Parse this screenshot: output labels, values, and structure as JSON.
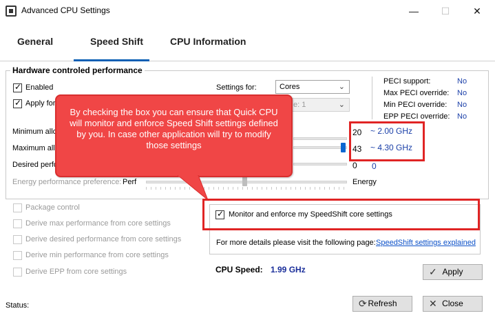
{
  "window": {
    "title": "Advanced CPU Settings",
    "min_glyph": "—",
    "max_glyph": "☐",
    "close_glyph": "✕"
  },
  "tabs": [
    {
      "label": "General",
      "active": false
    },
    {
      "label": "Speed Shift",
      "active": true
    },
    {
      "label": "CPU Information",
      "active": false
    }
  ],
  "hardware": {
    "title": "Hardware controled performance",
    "enabled_label": "Enabled",
    "apply_label": "Apply for",
    "settings_for_label": "Settings for:",
    "settings_for_value": "Cores",
    "core_select_value": "e: 1",
    "min_label": "Minimum allo",
    "max_label": "Maximum allo",
    "desired_label": "Desired perfo",
    "epp_label": "Energy performance preference:",
    "epp_left": "Perf",
    "epp_right": "Energy",
    "min_value": "20",
    "min_freq": "~ 2.00 GHz",
    "max_value": "43",
    "max_freq": "~ 4.30 GHz",
    "desired_value": "0",
    "desired_freq": "0"
  },
  "peci": [
    {
      "label": "PECI support:",
      "value": "No"
    },
    {
      "label": "Max PECI override:",
      "value": "No"
    },
    {
      "label": "Min PECI override:",
      "value": "No"
    },
    {
      "label": "EPP PECI override:",
      "value": "No"
    }
  ],
  "options": [
    {
      "label": "Package control"
    },
    {
      "label": "Derive max performance from core settings"
    },
    {
      "label": "Derive desired performance from core settings"
    },
    {
      "label": "Derive min performance from core settings"
    },
    {
      "label": "Derive EPP from core settings"
    }
  ],
  "monitor": {
    "label": "Monitor and enforce my SpeedShift core settings",
    "checked": true
  },
  "details": {
    "text": "For more details please visit the following page:",
    "link": "SpeedShift settings explained"
  },
  "cpu_speed": {
    "label": "CPU Speed:",
    "value": "1.99 GHz"
  },
  "callout": {
    "text": "By checking the box you can ensure that Quick CPU will monitor and enforce Speed Shift settings defined by you. In case other application will try to modify those settings"
  },
  "buttons": {
    "apply": "Apply",
    "refresh": "Refresh",
    "close": "Close"
  },
  "status": {
    "label": "Status:"
  },
  "colors": {
    "accent": "#0a5fb4",
    "highlight_red": "#e02424",
    "callout_red": "#f04646",
    "value_blue": "#1a3fa8"
  }
}
